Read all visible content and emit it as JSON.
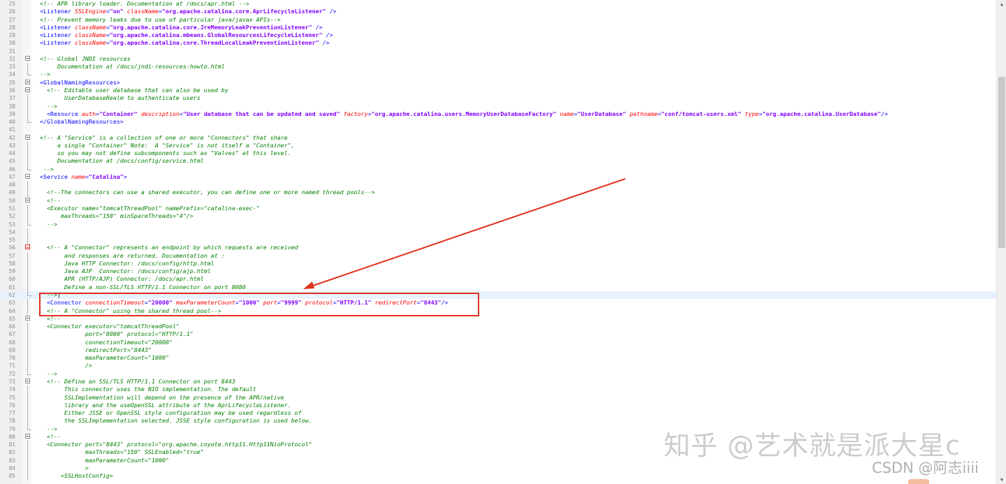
{
  "editor": {
    "lines": [
      {
        "n": "25",
        "fold": "",
        "parts": [
          {
            "t": "cm",
            "v": "<!-- APR library loader. Documentation at /docs/apr.html -->"
          }
        ]
      },
      {
        "n": "26",
        "fold": "",
        "parts": [
          {
            "t": "tg",
            "v": "<Listener "
          },
          {
            "t": "at",
            "v": "SSLEngine"
          },
          {
            "t": "tg",
            "v": "="
          },
          {
            "t": "vl",
            "v": "\"on\""
          },
          {
            "t": "tg",
            "v": " "
          },
          {
            "t": "at",
            "v": "className"
          },
          {
            "t": "tg",
            "v": "="
          },
          {
            "t": "vl",
            "v": "\"org.apache.catalina.core.AprLifecycleListener\""
          },
          {
            "t": "tg",
            "v": " />"
          }
        ]
      },
      {
        "n": "27",
        "fold": "",
        "parts": [
          {
            "t": "cm",
            "v": "<!-- Prevent memory leaks due to use of particular java/javax APIs-->"
          }
        ]
      },
      {
        "n": "28",
        "fold": "",
        "parts": [
          {
            "t": "tg",
            "v": "<Listener "
          },
          {
            "t": "at",
            "v": "className"
          },
          {
            "t": "tg",
            "v": "="
          },
          {
            "t": "vl",
            "v": "\"org.apache.catalina.core.JreMemoryLeakPreventionListener\""
          },
          {
            "t": "tg",
            "v": " />"
          }
        ]
      },
      {
        "n": "29",
        "fold": "",
        "parts": [
          {
            "t": "tg",
            "v": "<Listener "
          },
          {
            "t": "at",
            "v": "className"
          },
          {
            "t": "tg",
            "v": "="
          },
          {
            "t": "vl",
            "v": "\"org.apache.catalina.mbeans.GlobalResourcesLifecycleListener\""
          },
          {
            "t": "tg",
            "v": " />"
          }
        ]
      },
      {
        "n": "30",
        "fold": "",
        "parts": [
          {
            "t": "tg",
            "v": "<Listener "
          },
          {
            "t": "at",
            "v": "className"
          },
          {
            "t": "tg",
            "v": "="
          },
          {
            "t": "vl",
            "v": "\"org.apache.catalina.core.ThreadLocalLeakPreventionListener\""
          },
          {
            "t": "tg",
            "v": " />"
          }
        ]
      },
      {
        "n": "31",
        "fold": "",
        "parts": []
      },
      {
        "n": "32",
        "fold": "open",
        "parts": [
          {
            "t": "cm",
            "v": "<!-- Global JNDI resources"
          }
        ]
      },
      {
        "n": "33",
        "fold": "line",
        "parts": [
          {
            "t": "cm",
            "v": "     Documentation at /docs/jndi-resources-howto.html"
          }
        ]
      },
      {
        "n": "34",
        "fold": "end",
        "parts": [
          {
            "t": "cm",
            "v": "-->"
          }
        ]
      },
      {
        "n": "35",
        "fold": "open",
        "parts": [
          {
            "t": "tg",
            "v": "<GlobalNamingResources>"
          }
        ]
      },
      {
        "n": "36",
        "fold": "open",
        "parts": [
          {
            "t": "cm",
            "v": "  <!-- Editable user database that can also be used by"
          }
        ]
      },
      {
        "n": "37",
        "fold": "line",
        "parts": [
          {
            "t": "cm",
            "v": "       UserDatabaseRealm to authenticate users"
          }
        ]
      },
      {
        "n": "38",
        "fold": "line",
        "parts": [
          {
            "t": "cm",
            "v": "  -->"
          }
        ]
      },
      {
        "n": "39",
        "fold": "line",
        "parts": [
          {
            "t": "tg",
            "v": "  <Resource "
          },
          {
            "t": "at",
            "v": "auth"
          },
          {
            "t": "tg",
            "v": "="
          },
          {
            "t": "vl",
            "v": "\"Container\""
          },
          {
            "t": "tg",
            "v": " "
          },
          {
            "t": "at",
            "v": "description"
          },
          {
            "t": "tg",
            "v": "="
          },
          {
            "t": "vl",
            "v": "\"User database that can be updated and saved\""
          },
          {
            "t": "tg",
            "v": " "
          },
          {
            "t": "at",
            "v": "factory"
          },
          {
            "t": "tg",
            "v": "="
          },
          {
            "t": "vl",
            "v": "\"org.apache.catalina.users.MemoryUserDatabaseFactory\""
          },
          {
            "t": "tg",
            "v": " "
          },
          {
            "t": "at",
            "v": "name"
          },
          {
            "t": "tg",
            "v": "="
          },
          {
            "t": "vl",
            "v": "\"UserDatabase\""
          },
          {
            "t": "tg",
            "v": " "
          },
          {
            "t": "at",
            "v": "pathname"
          },
          {
            "t": "tg",
            "v": "="
          },
          {
            "t": "vl",
            "v": "\"conf/tomcat-users.xml\""
          },
          {
            "t": "tg",
            "v": " "
          },
          {
            "t": "at",
            "v": "type"
          },
          {
            "t": "tg",
            "v": "="
          },
          {
            "t": "vl",
            "v": "\"org.apache.catalina.UserDatabase\""
          },
          {
            "t": "tg",
            "v": "/>"
          }
        ]
      },
      {
        "n": "40",
        "fold": "end",
        "parts": [
          {
            "t": "tg",
            "v": "</GlobalNamingResources>"
          }
        ]
      },
      {
        "n": "41",
        "fold": "",
        "parts": []
      },
      {
        "n": "42",
        "fold": "open",
        "parts": [
          {
            "t": "cm",
            "v": "<!-- A \"Service\" is a collection of one or more \"Connectors\" that share"
          }
        ]
      },
      {
        "n": "43",
        "fold": "line",
        "parts": [
          {
            "t": "cm",
            "v": "     a single \"Container\" Note:  A \"Service\" is not itself a \"Container\","
          }
        ]
      },
      {
        "n": "44",
        "fold": "line",
        "parts": [
          {
            "t": "cm",
            "v": "     so you may not define subcomponents such as \"Valves\" at this level."
          }
        ]
      },
      {
        "n": "45",
        "fold": "line",
        "parts": [
          {
            "t": "cm",
            "v": "     Documentation at /docs/config/service.html"
          }
        ]
      },
      {
        "n": "46",
        "fold": "end",
        "parts": [
          {
            "t": "cm",
            "v": " -->"
          }
        ]
      },
      {
        "n": "47",
        "fold": "open",
        "parts": [
          {
            "t": "tg",
            "v": "<Service "
          },
          {
            "t": "at",
            "v": "name"
          },
          {
            "t": "tg",
            "v": "="
          },
          {
            "t": "vl",
            "v": "\"Catalina\""
          },
          {
            "t": "tg",
            "v": ">"
          }
        ]
      },
      {
        "n": "48",
        "fold": "line",
        "parts": []
      },
      {
        "n": "49",
        "fold": "line",
        "parts": [
          {
            "t": "cm",
            "v": "  <!--The connectors can use a shared executor, you can define one or more named thread pools-->"
          }
        ]
      },
      {
        "n": "50",
        "fold": "open",
        "parts": [
          {
            "t": "cm",
            "v": "  <!--"
          }
        ]
      },
      {
        "n": "51",
        "fold": "line",
        "parts": [
          {
            "t": "cm",
            "v": "  <Executor name=\"tomcatThreadPool\" namePrefix=\"catalina-exec-\""
          }
        ]
      },
      {
        "n": "52",
        "fold": "line",
        "parts": [
          {
            "t": "cm",
            "v": "      maxThreads=\"150\" minSpareThreads=\"4\"/>"
          }
        ]
      },
      {
        "n": "53",
        "fold": "end",
        "parts": [
          {
            "t": "cm",
            "v": "  -->"
          }
        ]
      },
      {
        "n": "54",
        "fold": "line",
        "parts": []
      },
      {
        "n": "55",
        "fold": "line",
        "parts": []
      },
      {
        "n": "56",
        "fold": "red",
        "parts": [
          {
            "t": "cm",
            "v": "  <!-- A \"Connector\" represents an endpoint by which requests are received"
          }
        ]
      },
      {
        "n": "57",
        "fold": "line",
        "parts": [
          {
            "t": "cm",
            "v": "       and responses are returned. Documentation at :"
          }
        ]
      },
      {
        "n": "58",
        "fold": "line",
        "parts": [
          {
            "t": "cm",
            "v": "       Java HTTP Connector: /docs/config/http.html"
          }
        ]
      },
      {
        "n": "59",
        "fold": "line",
        "parts": [
          {
            "t": "cm",
            "v": "       Java AJP  Connector: /docs/config/ajp.html"
          }
        ]
      },
      {
        "n": "60",
        "fold": "line",
        "parts": [
          {
            "t": "cm",
            "v": "       APR (HTTP/AJP) Connector: /docs/apr.html"
          }
        ]
      },
      {
        "n": "61",
        "fold": "line",
        "parts": [
          {
            "t": "cm",
            "v": "       Define a non-SSL/TLS HTTP/1.1 Connector on port 8080"
          }
        ]
      },
      {
        "n": "62",
        "fold": "end",
        "current": true,
        "parts": [
          {
            "t": "cm",
            "v": "  -->"
          },
          {
            "t": "tx",
            "v": "|"
          }
        ]
      },
      {
        "n": "63",
        "fold": "line",
        "parts": [
          {
            "t": "tg",
            "v": "  <Connector "
          },
          {
            "t": "at",
            "v": "connectionTimeout"
          },
          {
            "t": "tg",
            "v": "="
          },
          {
            "t": "vl",
            "v": "\"20000\""
          },
          {
            "t": "tg",
            "v": " "
          },
          {
            "t": "at",
            "v": "maxParameterCount"
          },
          {
            "t": "tg",
            "v": "="
          },
          {
            "t": "vl",
            "v": "\"1000\""
          },
          {
            "t": "tg",
            "v": " "
          },
          {
            "t": "at",
            "v": "port"
          },
          {
            "t": "tg",
            "v": "="
          },
          {
            "t": "vl",
            "v": "\"9999\""
          },
          {
            "t": "tg",
            "v": " "
          },
          {
            "t": "at",
            "v": "protocol"
          },
          {
            "t": "tg",
            "v": "="
          },
          {
            "t": "vl",
            "v": "\"HTTP/1.1\""
          },
          {
            "t": "tg",
            "v": " "
          },
          {
            "t": "at",
            "v": "redirectPort"
          },
          {
            "t": "tg",
            "v": "="
          },
          {
            "t": "vl",
            "v": "\"8443\""
          },
          {
            "t": "tg",
            "v": "/>"
          }
        ]
      },
      {
        "n": "64",
        "fold": "line",
        "parts": [
          {
            "t": "cm",
            "v": "  <!-- A \"Connector\" using the shared thread pool-->"
          }
        ]
      },
      {
        "n": "65",
        "fold": "open",
        "parts": [
          {
            "t": "cm",
            "v": "  <!--"
          }
        ]
      },
      {
        "n": "66",
        "fold": "line",
        "parts": [
          {
            "t": "cm",
            "v": "  <Connector executor=\"tomcatThreadPool\""
          }
        ]
      },
      {
        "n": "67",
        "fold": "line",
        "parts": [
          {
            "t": "cm",
            "v": "             port=\"8080\" protocol=\"HTTP/1.1\""
          }
        ]
      },
      {
        "n": "68",
        "fold": "line",
        "parts": [
          {
            "t": "cm",
            "v": "             connectionTimeout=\"20000\""
          }
        ]
      },
      {
        "n": "69",
        "fold": "line",
        "parts": [
          {
            "t": "cm",
            "v": "             redirectPort=\"8443\""
          }
        ]
      },
      {
        "n": "70",
        "fold": "line",
        "parts": [
          {
            "t": "cm",
            "v": "             maxParameterCount=\"1000\""
          }
        ]
      },
      {
        "n": "71",
        "fold": "line",
        "parts": [
          {
            "t": "cm",
            "v": "             />"
          }
        ]
      },
      {
        "n": "72",
        "fold": "end",
        "parts": [
          {
            "t": "cm",
            "v": "  -->"
          }
        ]
      },
      {
        "n": "73",
        "fold": "open",
        "parts": [
          {
            "t": "cm",
            "v": "  <!-- Define an SSL/TLS HTTP/1.1 Connector on port 8443"
          }
        ]
      },
      {
        "n": "74",
        "fold": "line",
        "parts": [
          {
            "t": "cm",
            "v": "       This connector uses the NIO implementation. The default"
          }
        ]
      },
      {
        "n": "75",
        "fold": "line",
        "parts": [
          {
            "t": "cm",
            "v": "       SSLImplementation will depend on the presence of the APR/native"
          }
        ]
      },
      {
        "n": "76",
        "fold": "line",
        "parts": [
          {
            "t": "cm",
            "v": "       library and the useOpenSSL attribute of the AprLifecycleListener."
          }
        ]
      },
      {
        "n": "77",
        "fold": "line",
        "parts": [
          {
            "t": "cm",
            "v": "       Either JSSE or OpenSSL style configuration may be used regardless of"
          }
        ]
      },
      {
        "n": "78",
        "fold": "line",
        "parts": [
          {
            "t": "cm",
            "v": "       the SSLImplementation selected. JSSE style configuration is used below."
          }
        ]
      },
      {
        "n": "79",
        "fold": "end",
        "parts": [
          {
            "t": "cm",
            "v": "  -->"
          }
        ]
      },
      {
        "n": "80",
        "fold": "open",
        "parts": [
          {
            "t": "cm",
            "v": "  <!--"
          }
        ]
      },
      {
        "n": "81",
        "fold": "line",
        "parts": [
          {
            "t": "cm",
            "v": "  <Connector port=\"8443\" protocol=\"org.apache.coyote.http11.Http11NioProtocol\""
          }
        ]
      },
      {
        "n": "82",
        "fold": "line",
        "parts": [
          {
            "t": "cm",
            "v": "             maxThreads=\"150\" SSLEnabled=\"true\""
          }
        ]
      },
      {
        "n": "83",
        "fold": "line",
        "parts": [
          {
            "t": "cm",
            "v": "             maxParameterCount=\"1000\""
          }
        ]
      },
      {
        "n": "84",
        "fold": "line",
        "parts": [
          {
            "t": "cm",
            "v": "             >"
          }
        ]
      },
      {
        "n": "85",
        "fold": "line",
        "parts": [
          {
            "t": "cm",
            "v": "      <SSLHostConfig>"
          }
        ]
      }
    ]
  },
  "colors": {
    "comment": "#008000",
    "tag": "#0000ff",
    "attribute": "#ff0000",
    "value": "#8000ff",
    "annotation": "#e0301e",
    "current_line": "#e8f2fe"
  },
  "watermark": {
    "zhihu": "知乎 @艺术就是派大星c",
    "csdn": "CSDN @阿志iiii"
  }
}
